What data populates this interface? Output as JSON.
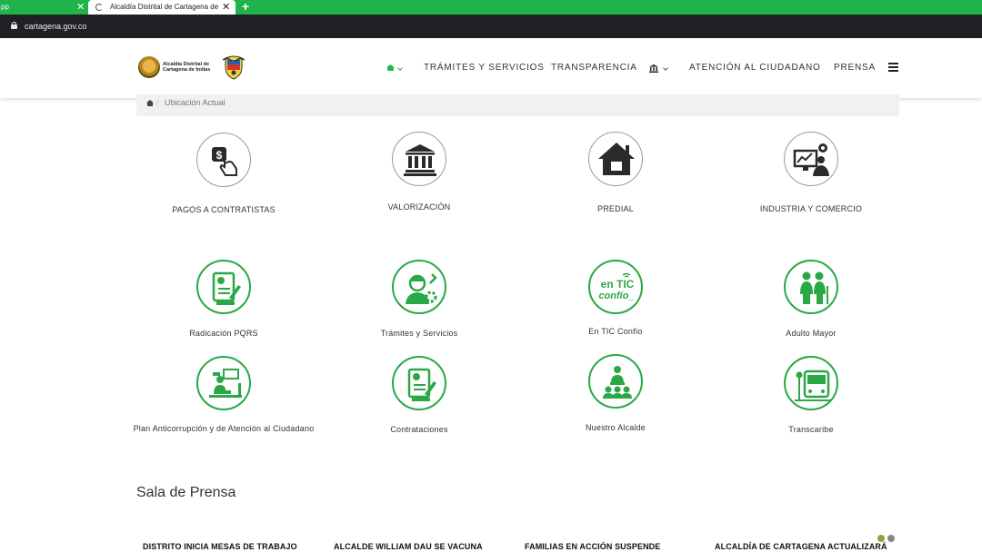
{
  "browser": {
    "prev_tab_label": "pp",
    "active_tab_label": "Alcaldía Distrital de Cartagena de",
    "close_glyph": "✕",
    "new_tab_glyph": "+",
    "url": "cartagena.gov.co",
    "accent_color": "#20b34a"
  },
  "header": {
    "logo_text_line1": "Alcaldía Distrital de",
    "logo_text_line2": "Cartagena de Indias",
    "nav": {
      "home_icon": "home-icon",
      "tramites": "TRÁMITES Y SERVICIOS",
      "transparencia": "TRANSPARENCIA",
      "institution_icon": "bank-icon",
      "atencion": "ATENCIÓN AL CIUDADANO",
      "prensa": "PRENSA",
      "menu_icon": "hamburger-icon"
    }
  },
  "breadcrumb": {
    "separator": "/",
    "current": "Ubicación Actual"
  },
  "tiles_row1": [
    {
      "label": "PAGOS A CONTRATISTAS",
      "icon": "payment-hand-icon"
    },
    {
      "label": "VALORIZACIÓN",
      "icon": "bank-building-icon"
    },
    {
      "label": "PREDIAL",
      "icon": "house-icon"
    },
    {
      "label": "INDUSTRIA Y COMERCIO",
      "icon": "industry-commerce-icon"
    }
  ],
  "tiles_row2": [
    {
      "label": "Radicación PQRS",
      "icon": "document-pen-icon"
    },
    {
      "label": "Trámites y Servicios",
      "icon": "worker-gear-icon"
    },
    {
      "label": "En TIC Confío",
      "icon": "en-tic-confio-icon",
      "icon_text_1": "en TIC",
      "icon_text_2": "confío_"
    },
    {
      "label": "Adulto Mayor",
      "icon": "elderly-couple-icon"
    }
  ],
  "tiles_row3": [
    {
      "label": "Plan Anticorrupción y de Atención al Ciudadano",
      "icon": "desk-worker-icon"
    },
    {
      "label": "Contrataciones",
      "icon": "contract-pen-icon"
    },
    {
      "label": "Nuestro Alcalde",
      "icon": "speaker-audience-icon"
    },
    {
      "label": "Transcaribe",
      "icon": "bus-stop-icon"
    }
  ],
  "press": {
    "title": "Sala de Prensa",
    "news": [
      "DISTRITO INICIA MESAS DE TRABAJO",
      "ALCALDE WILLIAM DAU SE VACUNA",
      "FAMILIAS EN ACCIÓN SUSPENDE",
      "ALCALDÍA DE CARTAGENA ACTUALIZARÁ"
    ],
    "dot_colors": [
      "#8aa63a",
      "#888888"
    ]
  }
}
